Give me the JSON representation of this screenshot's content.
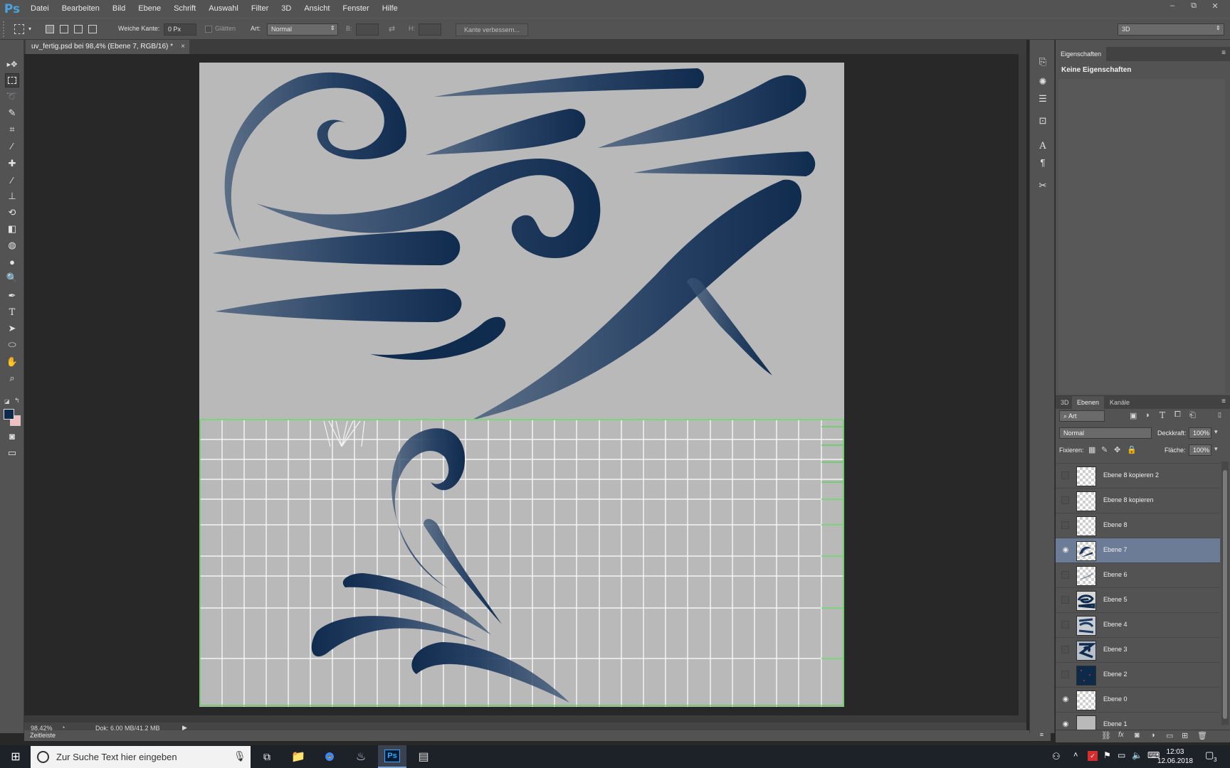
{
  "app": {
    "logo": "Ps"
  },
  "menu": [
    "Datei",
    "Bearbeiten",
    "Bild",
    "Ebene",
    "Schrift",
    "Auswahl",
    "Filter",
    "3D",
    "Ansicht",
    "Fenster",
    "Hilfe"
  ],
  "window_controls": {
    "minimize": "–",
    "restore": "⧉",
    "close": "✕"
  },
  "options": {
    "feather_label": "Weiche Kante:",
    "feather_value": "0 Px",
    "antialias_label": "Glätten",
    "style_label": "Art:",
    "style_value": "Normal",
    "width_label": "B:",
    "height_label": "H:",
    "refine_button": "Kante verbessern...",
    "workspace_value": "3D"
  },
  "document": {
    "tab_title": "uv_fertig.psd bei 98,4% (Ebene 7, RGB/16) *",
    "close": "×"
  },
  "status": {
    "zoom": "98,42%",
    "doc_info": "Dok: 6,00 MB/41,2 MB"
  },
  "timeline": {
    "label": "Zeitleiste"
  },
  "properties": {
    "tab": "Eigenschaften",
    "content": "Keine Eigenschaften"
  },
  "layers_panel": {
    "tabs": [
      "3D",
      "Ebenen",
      "Kanäle"
    ],
    "active_tab": "Ebenen",
    "filter_value": "Art",
    "blend_mode": "Normal",
    "opacity_label": "Deckkraft:",
    "opacity_value": "100%",
    "lock_label": "Fixieren:",
    "fill_label": "Fläche:",
    "fill_value": "100%",
    "layers": [
      {
        "name": "Ebene 8 kopieren 2",
        "visible": false,
        "selected": false,
        "thumb": "transparent"
      },
      {
        "name": "Ebene 8 kopieren",
        "visible": false,
        "selected": false,
        "thumb": "transparent"
      },
      {
        "name": "Ebene 8",
        "visible": false,
        "selected": false,
        "thumb": "transparent"
      },
      {
        "name": "Ebene 7",
        "visible": true,
        "selected": true,
        "thumb": "strokes"
      },
      {
        "name": "Ebene 6",
        "visible": false,
        "selected": false,
        "thumb": "transparent"
      },
      {
        "name": "Ebene 5",
        "visible": false,
        "selected": false,
        "thumb": "strokes-dark"
      },
      {
        "name": "Ebene 4",
        "visible": false,
        "selected": false,
        "thumb": "strokes-dark"
      },
      {
        "name": "Ebene 3",
        "visible": false,
        "selected": false,
        "thumb": "strokes-dark"
      },
      {
        "name": "Ebene 2",
        "visible": false,
        "selected": false,
        "thumb": "navy"
      },
      {
        "name": "Ebene 0",
        "visible": true,
        "selected": false,
        "thumb": "transparent"
      },
      {
        "name": "Ebene 1",
        "visible": true,
        "selected": false,
        "thumb": "gray"
      }
    ]
  },
  "taskbar": {
    "search_placeholder": "Zur Suche Text hier eingeben",
    "time": "12:03",
    "date": "12.06.2018",
    "notification_count": "3"
  },
  "colors": {
    "stroke": "#1e3a5f",
    "canvas_bg": "#b9b9b9",
    "guide_green": "#5fd35f",
    "selected_layer": "#6c7b96",
    "foreground": "#0d2a4a",
    "background": "#f0c0c0"
  }
}
